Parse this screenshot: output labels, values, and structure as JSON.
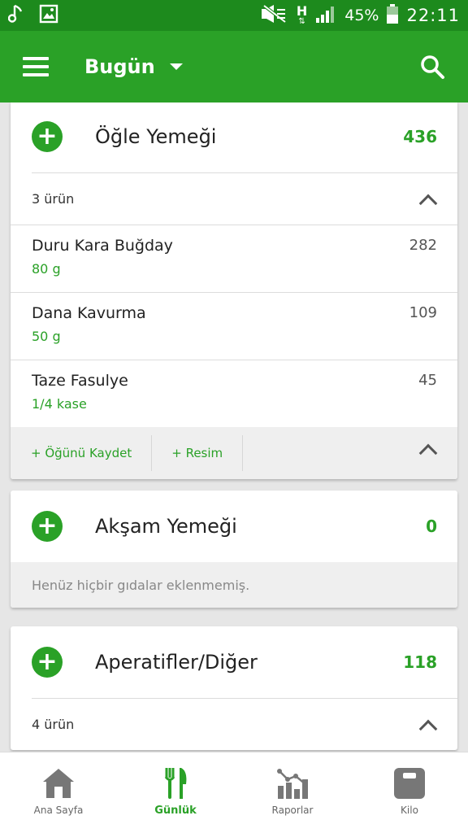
{
  "status_bar": {
    "network_type": "H",
    "battery": "45%",
    "time": "22:11"
  },
  "app_bar": {
    "title": "Bugün",
    "menu_icon": "hamburger-menu-icon",
    "search_icon": "search-icon"
  },
  "meals": [
    {
      "title": "Öğle Yemeği",
      "calories": "436",
      "count_label": "3 ürün",
      "items": [
        {
          "name": "Duru Kara Buğday",
          "quantity": "80  g",
          "calories": "282"
        },
        {
          "name": "Dana Kavurma",
          "quantity": "50  g",
          "calories": "109"
        },
        {
          "name": "Taze Fasulye",
          "quantity": "1/4 kase",
          "calories": "45"
        }
      ],
      "save_meal_label": "+ Öğünü Kaydet",
      "add_photo_label": "+ Resim"
    },
    {
      "title": "Akşam Yemeği",
      "calories": "0",
      "empty_message": "Henüz hiçbir gıdalar eklenmemiş."
    },
    {
      "title": "Aperatifler/Diğer",
      "calories": "118",
      "count_label": "4 ürün"
    }
  ],
  "bottom_nav": [
    {
      "label": "Ana Sayfa",
      "icon": "home-icon"
    },
    {
      "label": "Günlük",
      "icon": "fork-knife-icon",
      "active": true
    },
    {
      "label": "Raporlar",
      "icon": "chart-icon"
    },
    {
      "label": "Kilo",
      "icon": "scale-icon"
    }
  ],
  "colors": {
    "primary": "#2aa127",
    "status_bar": "#1d8a1d"
  }
}
